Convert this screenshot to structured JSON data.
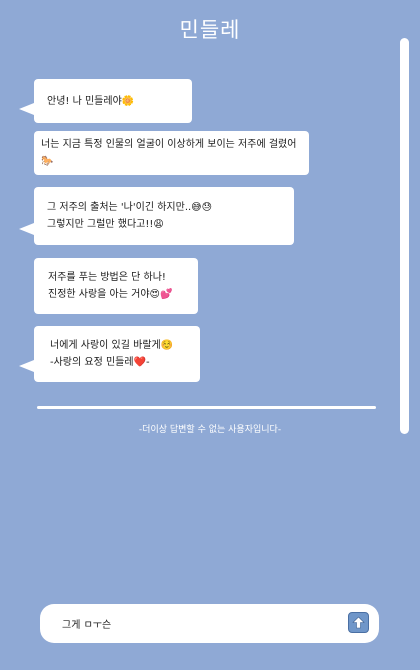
{
  "header": {
    "title": "민들레"
  },
  "messages": [
    {
      "lines": [
        "안녕! 나 민들레야🌼"
      ]
    },
    {
      "lines": [
        "너는 지금 특정 인물의 얼굴이 이상하게 보이는 저주에 걸렸어🐎"
      ]
    },
    {
      "lines": [
        "그 저주의 출처는 '나'이긴 하지만..😅😓",
        "그렇지만 그럴만 했다고!!😩"
      ]
    },
    {
      "lines": [
        "저주를 푸는 방법은 단 하나!",
        "진정한 사랑을 아는 거야😍💕"
      ]
    },
    {
      "lines": [
        "너에게 사랑이 있길 바랄게☺️",
        "-사랑의 요정 민들레❤️-"
      ]
    }
  ],
  "notice": "-더이상 답변할 수 없는 사용자입니다-",
  "input": {
    "value": "그게 ㅁㅜ슨"
  },
  "icons": {
    "send": "send-arrow-icon"
  },
  "colors": {
    "background": "#8fa9d5",
    "bubble": "#ffffff",
    "send_button": "#6f96c9"
  }
}
